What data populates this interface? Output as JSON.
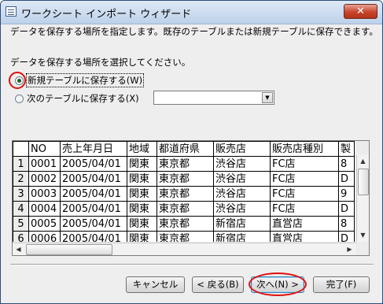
{
  "window": {
    "title": "ワークシート インポート ウィザード",
    "close_glyph": "✕"
  },
  "instruction": "データを保存する場所を指定します。既存のテーブルまたは新規テーブルに保存できます。",
  "location_prompt": "データを保存する場所を選択してください。",
  "options": {
    "new_table_label": "新規テーブルに保存する(W)",
    "new_table_selected": true,
    "existing_table_label": "次のテーブルに保存する(X)",
    "existing_table_selected": false,
    "existing_table_value": ""
  },
  "grid": {
    "columns": [
      "NO",
      "売上年月日",
      "地域",
      "都道府県",
      "販売店",
      "販売店種別",
      "製"
    ],
    "rows": [
      {
        "num": "1",
        "cells": [
          "0001",
          "2005/04/01",
          "関東",
          "東京都",
          "渋谷店",
          "FC店",
          "8"
        ]
      },
      {
        "num": "2",
        "cells": [
          "0002",
          "2005/04/01",
          "関東",
          "東京都",
          "渋谷店",
          "FC店",
          "D"
        ]
      },
      {
        "num": "3",
        "cells": [
          "0003",
          "2005/04/01",
          "関東",
          "東京都",
          "渋谷店",
          "FC店",
          "9"
        ]
      },
      {
        "num": "4",
        "cells": [
          "0004",
          "2005/04/01",
          "関東",
          "東京都",
          "渋谷店",
          "FC店",
          "D"
        ]
      },
      {
        "num": "5",
        "cells": [
          "0005",
          "2005/04/01",
          "関東",
          "東京都",
          "新宿店",
          "直営店",
          "8"
        ]
      },
      {
        "num": "6",
        "cells": [
          "0006",
          "2005/04/01",
          "関東",
          "東京都",
          "新宿店",
          "直営店",
          "D"
        ]
      }
    ]
  },
  "buttons": {
    "cancel": "キャンセル",
    "back": "< 戻る(B)",
    "next": "次へ(N) >",
    "finish": "完了(F)"
  },
  "colors": {
    "highlight_annotation": "#e01010",
    "title_bar": "#bdd1ea",
    "close_button": "#c7442a"
  }
}
